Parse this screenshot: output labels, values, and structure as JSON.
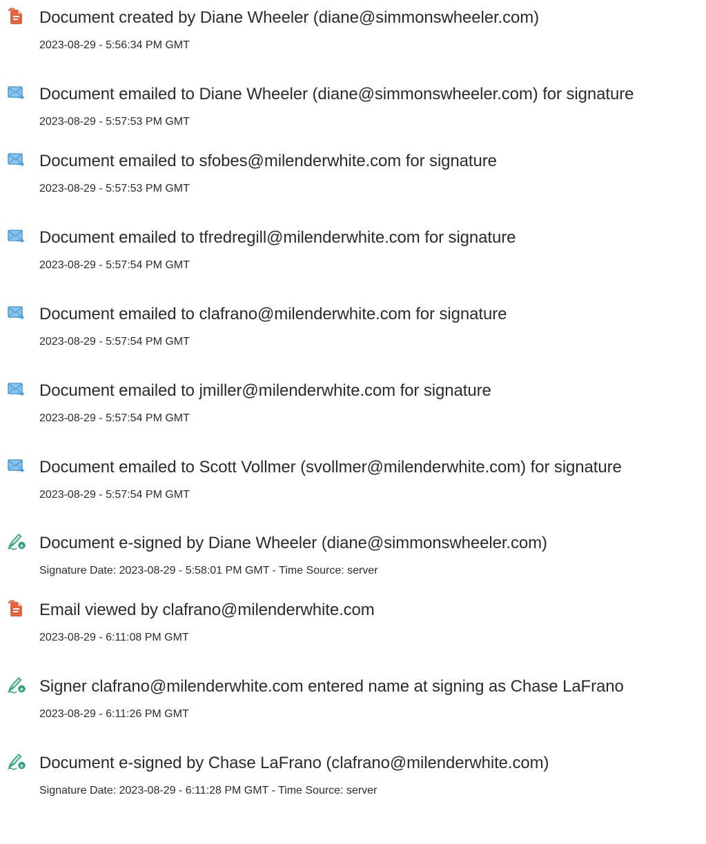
{
  "colors": {
    "created_icon": "#e8623a",
    "email_icon": "#4a9fd8",
    "sign_icon": "#2e9d7f",
    "text": "#2b2b2b"
  },
  "events": [
    {
      "icon": "document-created-icon",
      "title": "Document created by Diane Wheeler (diane@simmonswheeler.com)",
      "detail": "2023-08-29 - 5:56:34 PM GMT"
    },
    {
      "icon": "email-sent-icon",
      "title": "Document emailed to Diane Wheeler (diane@simmonswheeler.com) for signature",
      "detail": "2023-08-29 - 5:57:53 PM GMT"
    },
    {
      "icon": "email-sent-icon",
      "title": "Document emailed to sfobes@milenderwhite.com for signature",
      "detail": "2023-08-29 - 5:57:53 PM GMT"
    },
    {
      "icon": "email-sent-icon",
      "title": "Document emailed to tfredregill@milenderwhite.com for signature",
      "detail": "2023-08-29 - 5:57:54 PM GMT"
    },
    {
      "icon": "email-sent-icon",
      "title": "Document emailed to clafrano@milenderwhite.com for signature",
      "detail": "2023-08-29 - 5:57:54 PM GMT"
    },
    {
      "icon": "email-sent-icon",
      "title": "Document emailed to jmiller@milenderwhite.com for signature",
      "detail": "2023-08-29 - 5:57:54 PM GMT"
    },
    {
      "icon": "email-sent-icon",
      "title": "Document emailed to Scott Vollmer (svollmer@milenderwhite.com) for signature",
      "detail": "2023-08-29 - 5:57:54 PM GMT"
    },
    {
      "icon": "e-sign-icon",
      "title": "Document e-signed by Diane Wheeler (diane@simmonswheeler.com)",
      "detail": "Signature Date: 2023-08-29 - 5:58:01 PM GMT - Time Source: server"
    },
    {
      "icon": "document-viewed-icon",
      "title": "Email viewed by clafrano@milenderwhite.com",
      "detail": "2023-08-29 - 6:11:08 PM GMT"
    },
    {
      "icon": "e-sign-icon",
      "title": "Signer clafrano@milenderwhite.com entered name at signing as Chase LaFrano",
      "detail": "2023-08-29 - 6:11:26 PM GMT"
    },
    {
      "icon": "e-sign-icon",
      "title": "Document e-signed by Chase LaFrano (clafrano@milenderwhite.com)",
      "detail": "Signature Date: 2023-08-29 - 6:11:28 PM GMT - Time Source: server"
    }
  ]
}
